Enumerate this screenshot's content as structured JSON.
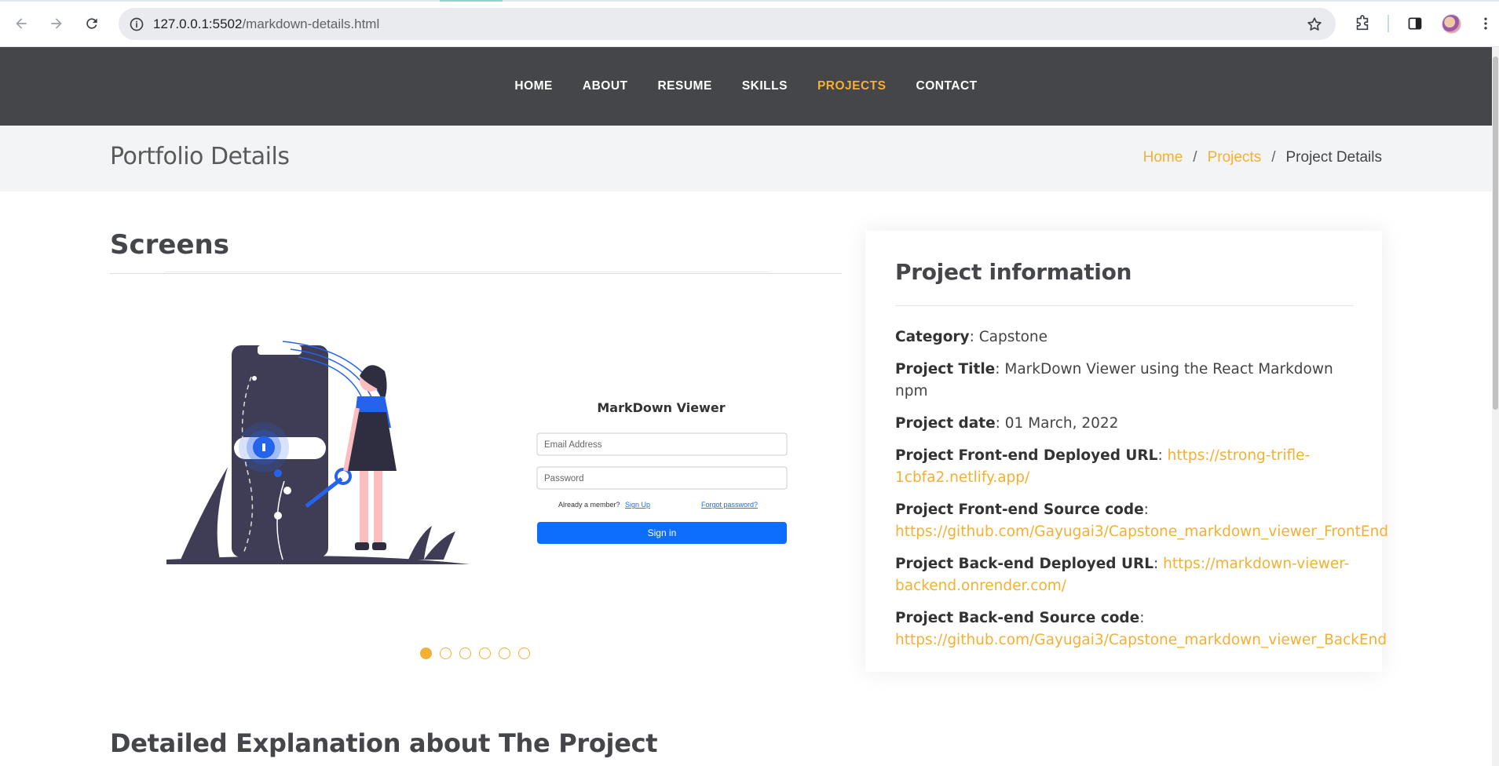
{
  "browser": {
    "url_host": "127.0.0.1:5502",
    "url_path": "/markdown-details.html"
  },
  "nav": {
    "items": [
      {
        "label": "HOME",
        "active": false
      },
      {
        "label": "ABOUT",
        "active": false
      },
      {
        "label": "RESUME",
        "active": false
      },
      {
        "label": "SKILLS",
        "active": false
      },
      {
        "label": "PROJECTS",
        "active": true
      },
      {
        "label": "CONTACT",
        "active": false
      }
    ]
  },
  "breadcrumbs": {
    "title": "Portfolio Details",
    "trail": [
      "Home",
      "Projects",
      "Project Details"
    ],
    "separator": "/"
  },
  "screens": {
    "title": "Screens",
    "slide": {
      "app_title": "MarkDown Viewer",
      "email_placeholder": "Email Address",
      "password_placeholder": "Password",
      "member_text": "Already a member?",
      "signup_link": "Sign Up",
      "forgot_link": "Forgot password?",
      "signin_button": "Sign in"
    },
    "dots_count": 6,
    "active_dot": 0
  },
  "project_info": {
    "title": "Project information",
    "rows": [
      {
        "label": "Category",
        "value": "Capstone",
        "is_link": false
      },
      {
        "label": "Project Title",
        "value": "MarkDown Viewer using the React Markdown npm",
        "is_link": false
      },
      {
        "label": "Project date",
        "value": "01 March, 2022",
        "is_link": false
      },
      {
        "label": "Project Front-end Deployed URL",
        "value": "https://strong-trifle-1cbfa2.netlify.app/",
        "is_link": true
      },
      {
        "label": "Project Front-end Source code",
        "value": "https://github.com/Gayugai3/Capstone_markdown_viewer_FrontEnd",
        "is_link": true
      },
      {
        "label": "Project Back-end Deployed URL",
        "value": "https://markdown-viewer-backend.onrender.com/",
        "is_link": true
      },
      {
        "label": "Project Back-end Source code",
        "value": "https://github.com/Gayugai3/Capstone_markdown_viewer_BackEnd",
        "is_link": true
      }
    ]
  },
  "detail": {
    "title": "Detailed Explanation about The Project"
  },
  "colors": {
    "accent": "#f4b032",
    "header_bg": "#45464a",
    "breadcrumb_bg": "#f3f4f6",
    "signin_blue": "#0d6efd"
  }
}
